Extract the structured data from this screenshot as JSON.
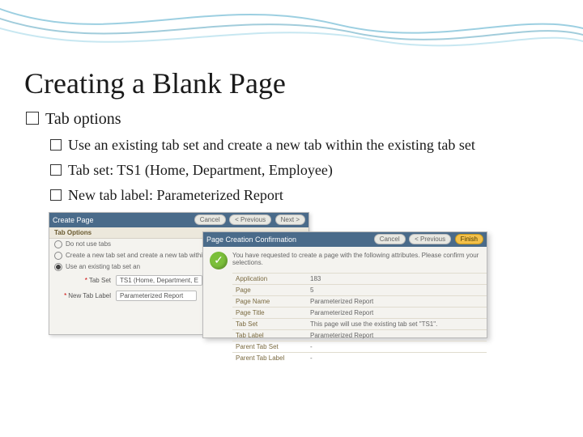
{
  "slide": {
    "title": "Creating a Blank Page",
    "bullet1": "Tab options",
    "sub1": "Use an existing tab set and create a new tab within the existing tab set",
    "sub2": "Tab set: TS1 (Home, Department, Employee)",
    "sub3": "New tab label: Parameterized Report"
  },
  "scr1": {
    "header": "Create Page",
    "btn_cancel": "Cancel",
    "btn_prev": "< Previous",
    "btn_next": "Next >",
    "section": "Tab Options",
    "opt1": "Do not use tabs",
    "opt2": "Create a new tab set and create a new tab within the new tab set",
    "opt3": "Use an existing tab set an",
    "field_tabset": "Tab Set",
    "val_tabset": "TS1 (Home, Department, E",
    "field_newtab": "New Tab Label",
    "val_newtab": "Parameterized Report"
  },
  "scr2": {
    "header": "Page Creation Confirmation",
    "btn_cancel": "Cancel",
    "btn_prev": "< Previous",
    "btn_finish": "Finish",
    "message": "You have requested to create a page with the following attributes. Please confirm your selections.",
    "rows": {
      "application_l": "Application",
      "application_v": "183",
      "page_l": "Page",
      "page_v": "5",
      "pagename_l": "Page Name",
      "pagename_v": "Parameterized Report",
      "pagetitle_l": "Page Title",
      "pagetitle_v": "Parameterized Report",
      "tabset_l": "Tab Set",
      "tabset_v": "This page will use the existing tab set \"TS1\".",
      "tablabel_l": "Tab Label",
      "tablabel_v": "Parameterized Report",
      "parenttabset_l": "Parent Tab Set",
      "parenttabset_v": "-",
      "parenttablabel_l": "Parent Tab Label",
      "parenttablabel_v": "-"
    }
  }
}
